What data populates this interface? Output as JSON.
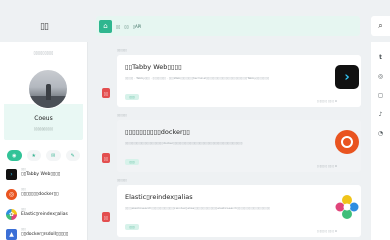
{
  "brand": {
    "glyph": "▯▯"
  },
  "sidebar": {
    "header": "▯▯▯▯▯▯▯▯▯",
    "profile": {
      "name": "Coeus",
      "bio": "▯▯▯▯▯▯▯▯▯▯"
    },
    "tabs": [
      {
        "name": "tab-recent",
        "icon": "◉"
      },
      {
        "name": "tab-favorite",
        "icon": "★"
      },
      {
        "name": "tab-comment",
        "icon": "✉"
      },
      {
        "name": "tab-tag",
        "icon": "✎"
      }
    ],
    "items": [
      {
        "date": "▯▯▯",
        "title": "▯▯Tabby Web▯▯▯▯",
        "thumb_color": "#111111",
        "thumb_glyph": "›"
      },
      {
        "date": "▯▯▯",
        "title": "▯▯▯▯▯▯▯docker▯▯",
        "thumb_color": "#e95420",
        "thumb_glyph": "◎"
      },
      {
        "date": "▯▯▯",
        "title": "Elastic▯reindex▯alias",
        "thumb_color": "#f5c518",
        "thumb_glyph": "✿"
      },
      {
        "date": "▯▯▯",
        "title": "▯▯docker▯rsdoll▯▯▯▯▯",
        "thumb_color": "#3b6fd6",
        "thumb_glyph": "▲"
      }
    ]
  },
  "topbar": {
    "home_icon": "⌂",
    "links": [
      "▯▯",
      "▯▯",
      "▯API"
    ]
  },
  "search": {
    "icon": "⌕"
  },
  "rail": {
    "icons": [
      "t",
      "◎",
      "◻",
      "♪",
      "◔"
    ]
  },
  "posts": [
    {
      "date": "▯▯▯▯▯▯",
      "title": "▯▯Tabby Web▯▯▯▯",
      "desc": "▯▯▯▯▯ · Tabby▯▯▯ · ▯▯▯▯▯▯▯▯ · ▯▯▯Web▯▯▯▯▯▯▯▯terminal▯▯▯▯▯▯▯▯▯▯▯▯▯▯▯▯▯▯▯▯▯▯▯▯▯Tabby▯▯▯▯▯▯▯▯",
      "tag": "▯▯▯",
      "meta": "▯ ▯▯▯ ▯ ▯▯ ▯ 0",
      "badge": "▯▯",
      "thumb": "tabby",
      "highlight": false
    },
    {
      "date": "▯▯▯▯▯▯",
      "title": "▯▯▯▯▯▯▯▯▯▯docker▯▯",
      "desc": "▯▯▯▯▯▯▯▯▯▯▯▯▯▯▯▯▯▯▯▯▯▯▯docker▯▯▯▯▯▯▯▯▯▯▯▯▯▯▯▯▯▯▯▯▯▯▯▯▯▯▯▯▯▯▯▯▯▯▯▯▯▯▯▯▯▯",
      "tag": "▯▯▯",
      "meta": "▯ ▯▯▯ ▯ ▯▯ ▯ 0",
      "badge": "▯▯",
      "thumb": "ubuntu",
      "highlight": true
    },
    {
      "date": "▯▯▯▯▯▯",
      "title": "Elastic▯reindex▯alias",
      "desc": "▯▯▯▯elasticsearch▯▯▯▯▯▯▯▯▯▯▯▯▯▯reindex▯alias▯▯▯▯▯▯▯▯▯▯▯▯▯▯elasticsearch▯▯▯▯▯▯▯▯▯▯▯▯▯▯▯▯▯▯▯▯",
      "tag": "▯▯▯",
      "meta": "▯ ▯▯▯ ▯ ▯▯ ▯ 0",
      "badge": "▯▯",
      "thumb": "elastic",
      "highlight": false
    }
  ],
  "colors": {
    "accent": "#32c398",
    "badge": "#e34f4f",
    "topbar_bg": "#e6f6f1"
  }
}
